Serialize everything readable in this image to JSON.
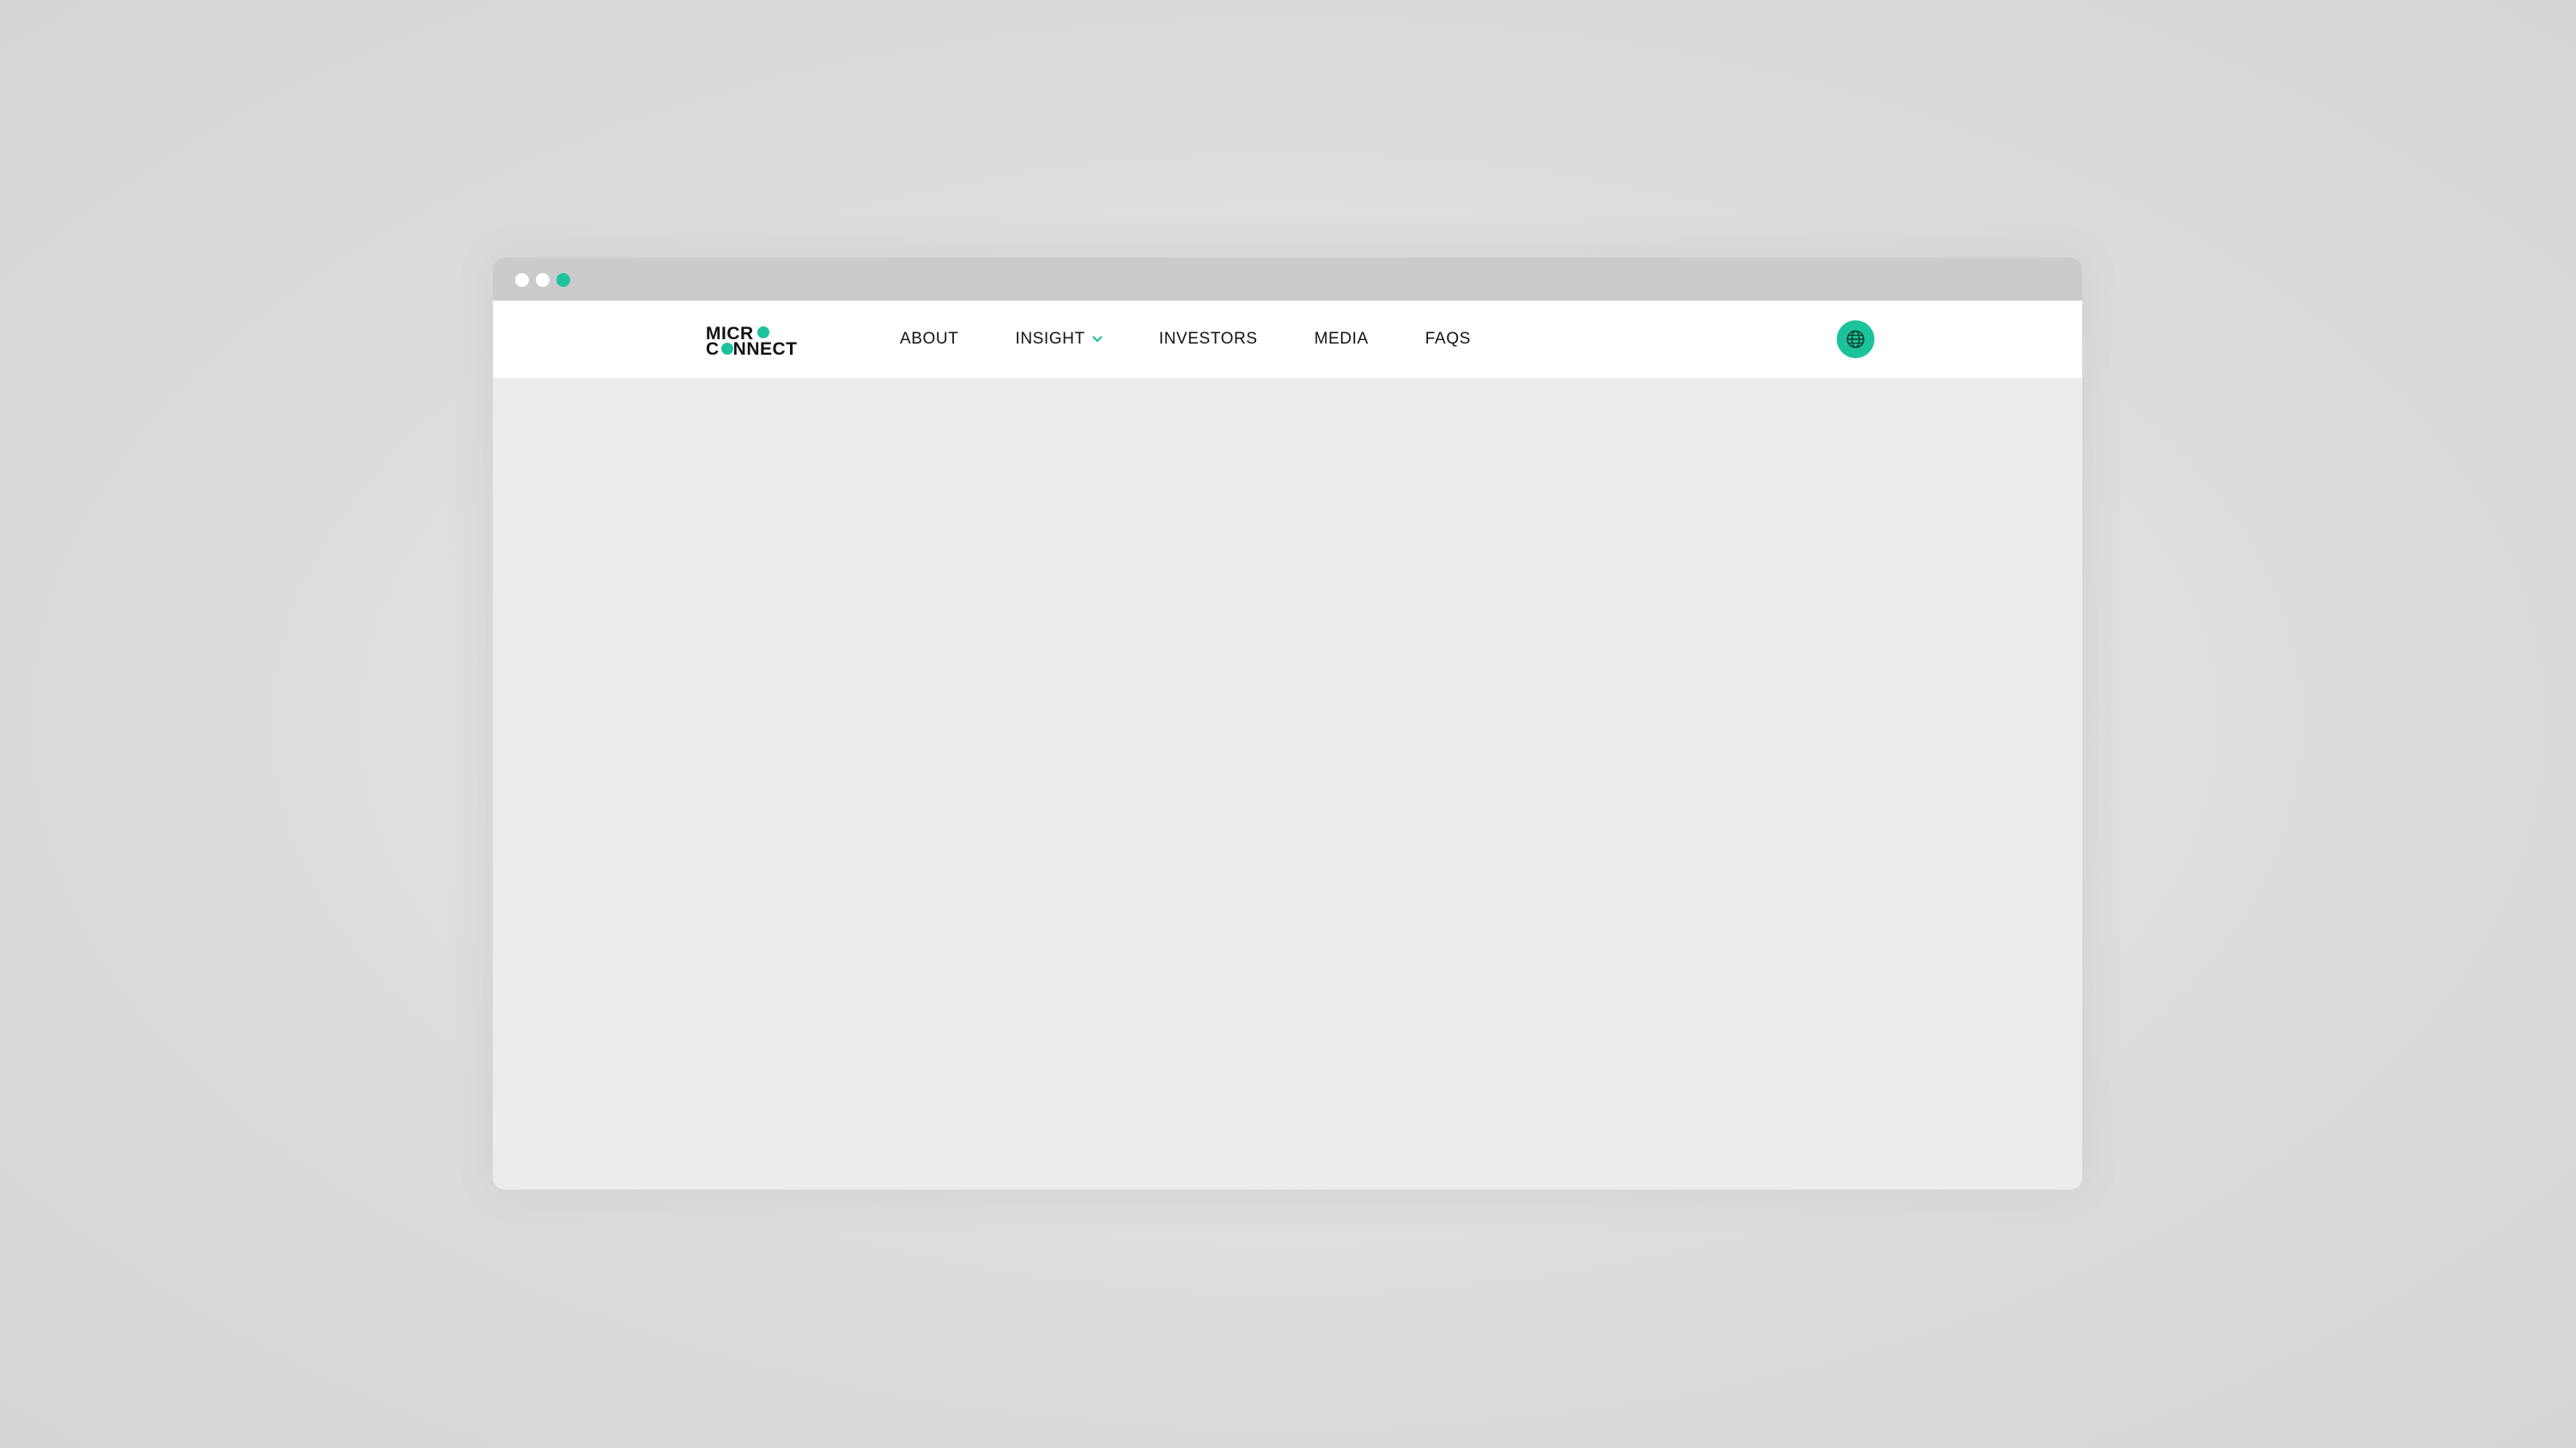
{
  "logo": {
    "line1": "MICR",
    "line2_a": "C",
    "line2_b": "NNECT"
  },
  "nav": {
    "items": [
      {
        "label": "ABOUT"
      },
      {
        "label": "INSIGHT",
        "has_dropdown": true
      },
      {
        "label": "INVESTORS"
      },
      {
        "label": "MEDIA"
      },
      {
        "label": "FAQS"
      }
    ]
  },
  "icons": {
    "dropdown": "chevron-down-icon",
    "language": "globe-icon"
  },
  "colors": {
    "accent": "#1cc39a",
    "header_bg": "#ffffff",
    "content_bg": "#ececec",
    "titlebar_bg": "#cbcbcb",
    "text": "#111111"
  }
}
